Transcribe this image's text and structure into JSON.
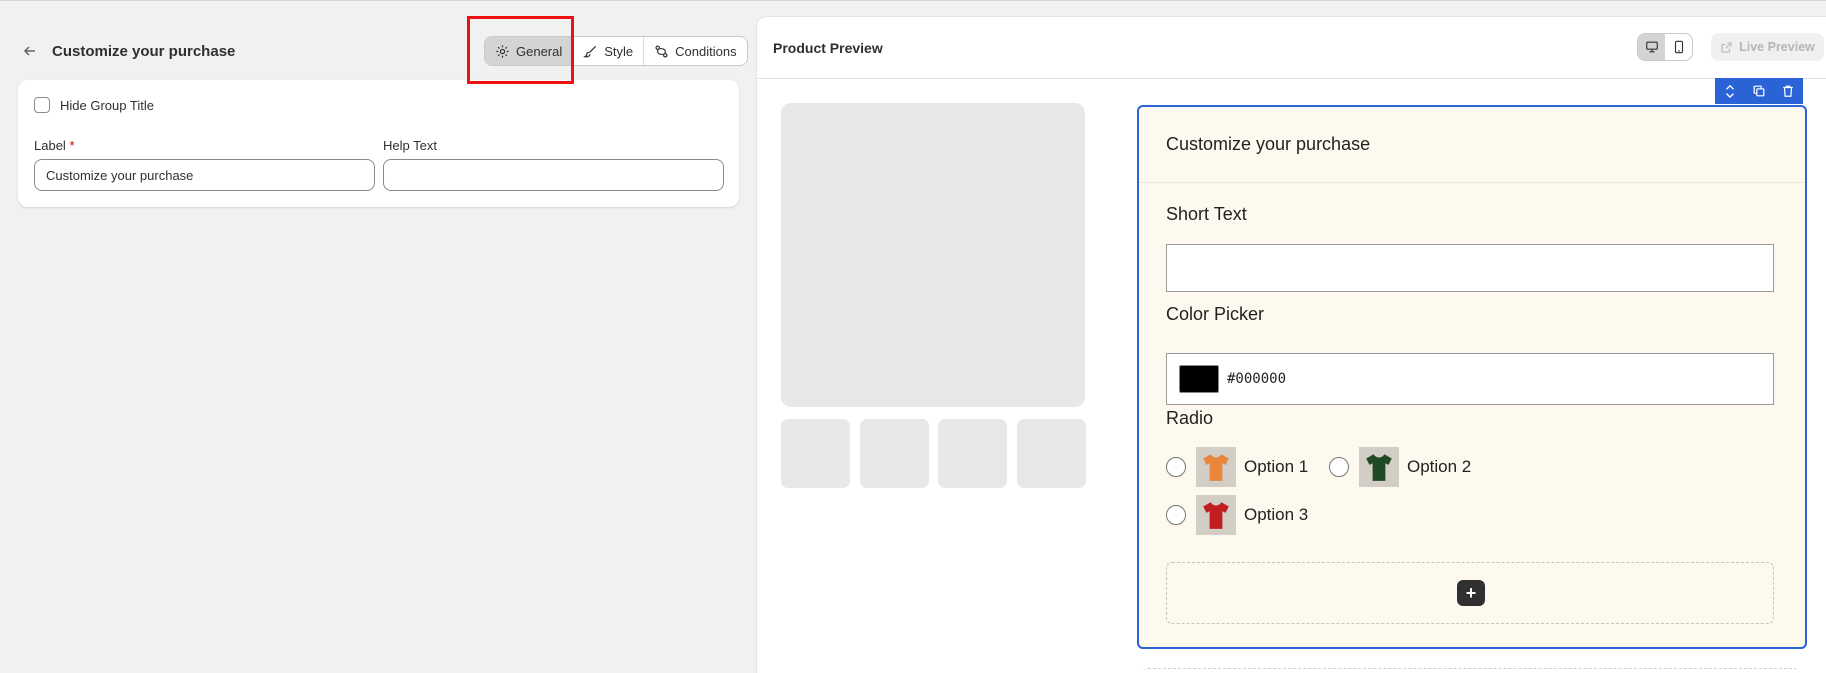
{
  "left": {
    "header": {
      "title": "Customize your purchase"
    },
    "tabs": [
      {
        "label": "General",
        "icon": "gear-icon",
        "active": true
      },
      {
        "label": "Style",
        "icon": "brush-icon",
        "active": false
      },
      {
        "label": "Conditions",
        "icon": "branch-icon",
        "active": false
      }
    ],
    "card": {
      "hide_title_label": "Hide Group Title",
      "label_field": {
        "label": "Label",
        "required_mark": "*",
        "value": "Customize your purchase"
      },
      "help_field": {
        "label": "Help Text",
        "value": ""
      }
    }
  },
  "preview": {
    "title": "Product Preview",
    "live_preview_label": "Live Preview",
    "form": {
      "title": "Customize your purchase",
      "short_text_label": "Short Text",
      "color_picker_label": "Color Picker",
      "color_value": "#000000",
      "radio_label": "Radio",
      "options": [
        {
          "label": "Option 1",
          "shirt_color": "#e8873a"
        },
        {
          "label": "Option 2",
          "shirt_color": "#1f4a25"
        },
        {
          "label": "Option 3",
          "shirt_color": "#c21d1f"
        }
      ],
      "add_label": "+"
    }
  },
  "colors": {
    "accent": "#2a63d6",
    "highlight": "#ee1111"
  }
}
